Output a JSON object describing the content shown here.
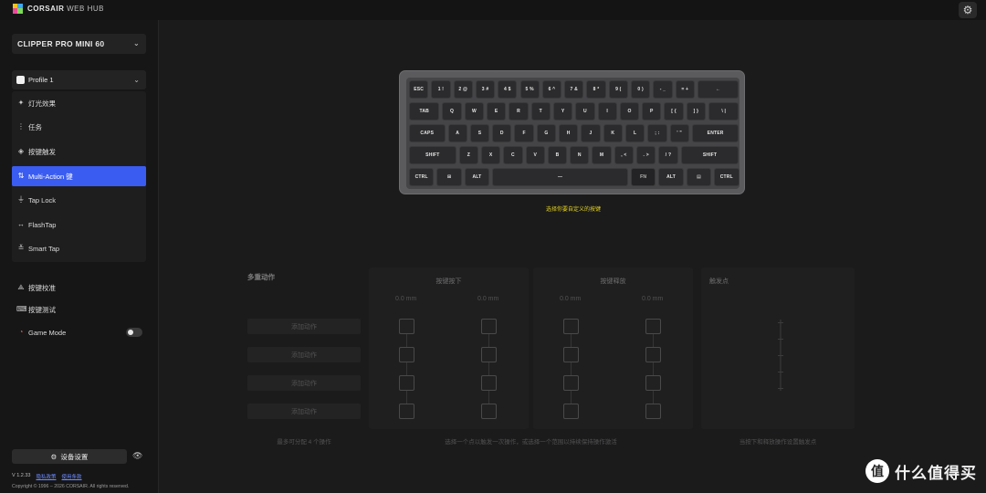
{
  "header": {
    "brand_strong": "CORSAIR",
    "brand_light": "WEB HUB",
    "settings_icon": "gear-icon"
  },
  "sidebar": {
    "device": "CLIPPER PRO MINI 60",
    "profile": "Profile 1",
    "menu": [
      {
        "label": "灯光效果",
        "icon": "sparkle-icon",
        "active": false
      },
      {
        "label": "任务",
        "icon": "tasks-icon",
        "active": false
      },
      {
        "label": "按键触发",
        "icon": "layers-icon",
        "active": false
      },
      {
        "label": "Multi-Action 键",
        "icon": "multi-action-icon",
        "active": true
      },
      {
        "label": "Tap Lock",
        "icon": "tap-lock-icon",
        "active": false
      },
      {
        "label": "FlashTap",
        "icon": "flashtap-icon",
        "active": false
      },
      {
        "label": "Smart Tap",
        "icon": "smart-tap-icon",
        "active": false
      }
    ],
    "tools": [
      {
        "label": "按键校准",
        "icon": "calibrate-icon"
      },
      {
        "label": "按键测试",
        "icon": "key-test-icon"
      },
      {
        "label": "Game Mode",
        "icon": "game-mode-icon",
        "toggle": false
      }
    ],
    "device_settings": "设备设置",
    "version": "V 1.2.33",
    "privacy_link": "隐私政策",
    "terms_link": "使用条款",
    "copyright": "Copyright © 1996 – 2026 CORSAIR. All rights reserved."
  },
  "keyboard": {
    "rows": [
      [
        "ESC",
        "1 !",
        "2 @",
        "3 #",
        "4 $",
        "5 %",
        "6 ^",
        "7 &",
        "8 *",
        "9 (",
        "0 )",
        "- _",
        "= +",
        "←"
      ],
      [
        "TAB",
        "Q",
        "W",
        "E",
        "R",
        "T",
        "Y",
        "U",
        "I",
        "O",
        "P",
        "[ {",
        "] }",
        "\\ |"
      ],
      [
        "CAPS",
        "A",
        "S",
        "D",
        "F",
        "G",
        "H",
        "J",
        "K",
        "L",
        "; :",
        "' \"",
        "ENTER"
      ],
      [
        "SHIFT",
        "Z",
        "X",
        "C",
        "V",
        "B",
        "N",
        "M",
        ", <",
        ". >",
        "/ ?",
        "SHIFT"
      ],
      [
        "CTRL",
        "⊞",
        "ALT",
        "—",
        "FN",
        "ALT",
        "▤",
        "CTRL"
      ]
    ],
    "hint": "选择你要自定义的按键"
  },
  "multi_action": {
    "title": "多重动作",
    "actions": [
      "添加动作",
      "添加动作",
      "添加动作",
      "添加动作"
    ],
    "footer": "最多可分配 4 个操作",
    "press_title": "按键按下",
    "release_title": "按键释放",
    "distances": [
      "0.0 mm",
      "0.0 mm",
      "0.0 mm",
      "0.0 mm"
    ],
    "columns_footer": "选择一个点以触发一次操作，或选择一个范围以持续保持操作激活",
    "trigger_title": "触发点",
    "trigger_footer": "当按下和释放操作设置触发点"
  },
  "watermark": {
    "badge": "值",
    "text": "什么值得买"
  }
}
